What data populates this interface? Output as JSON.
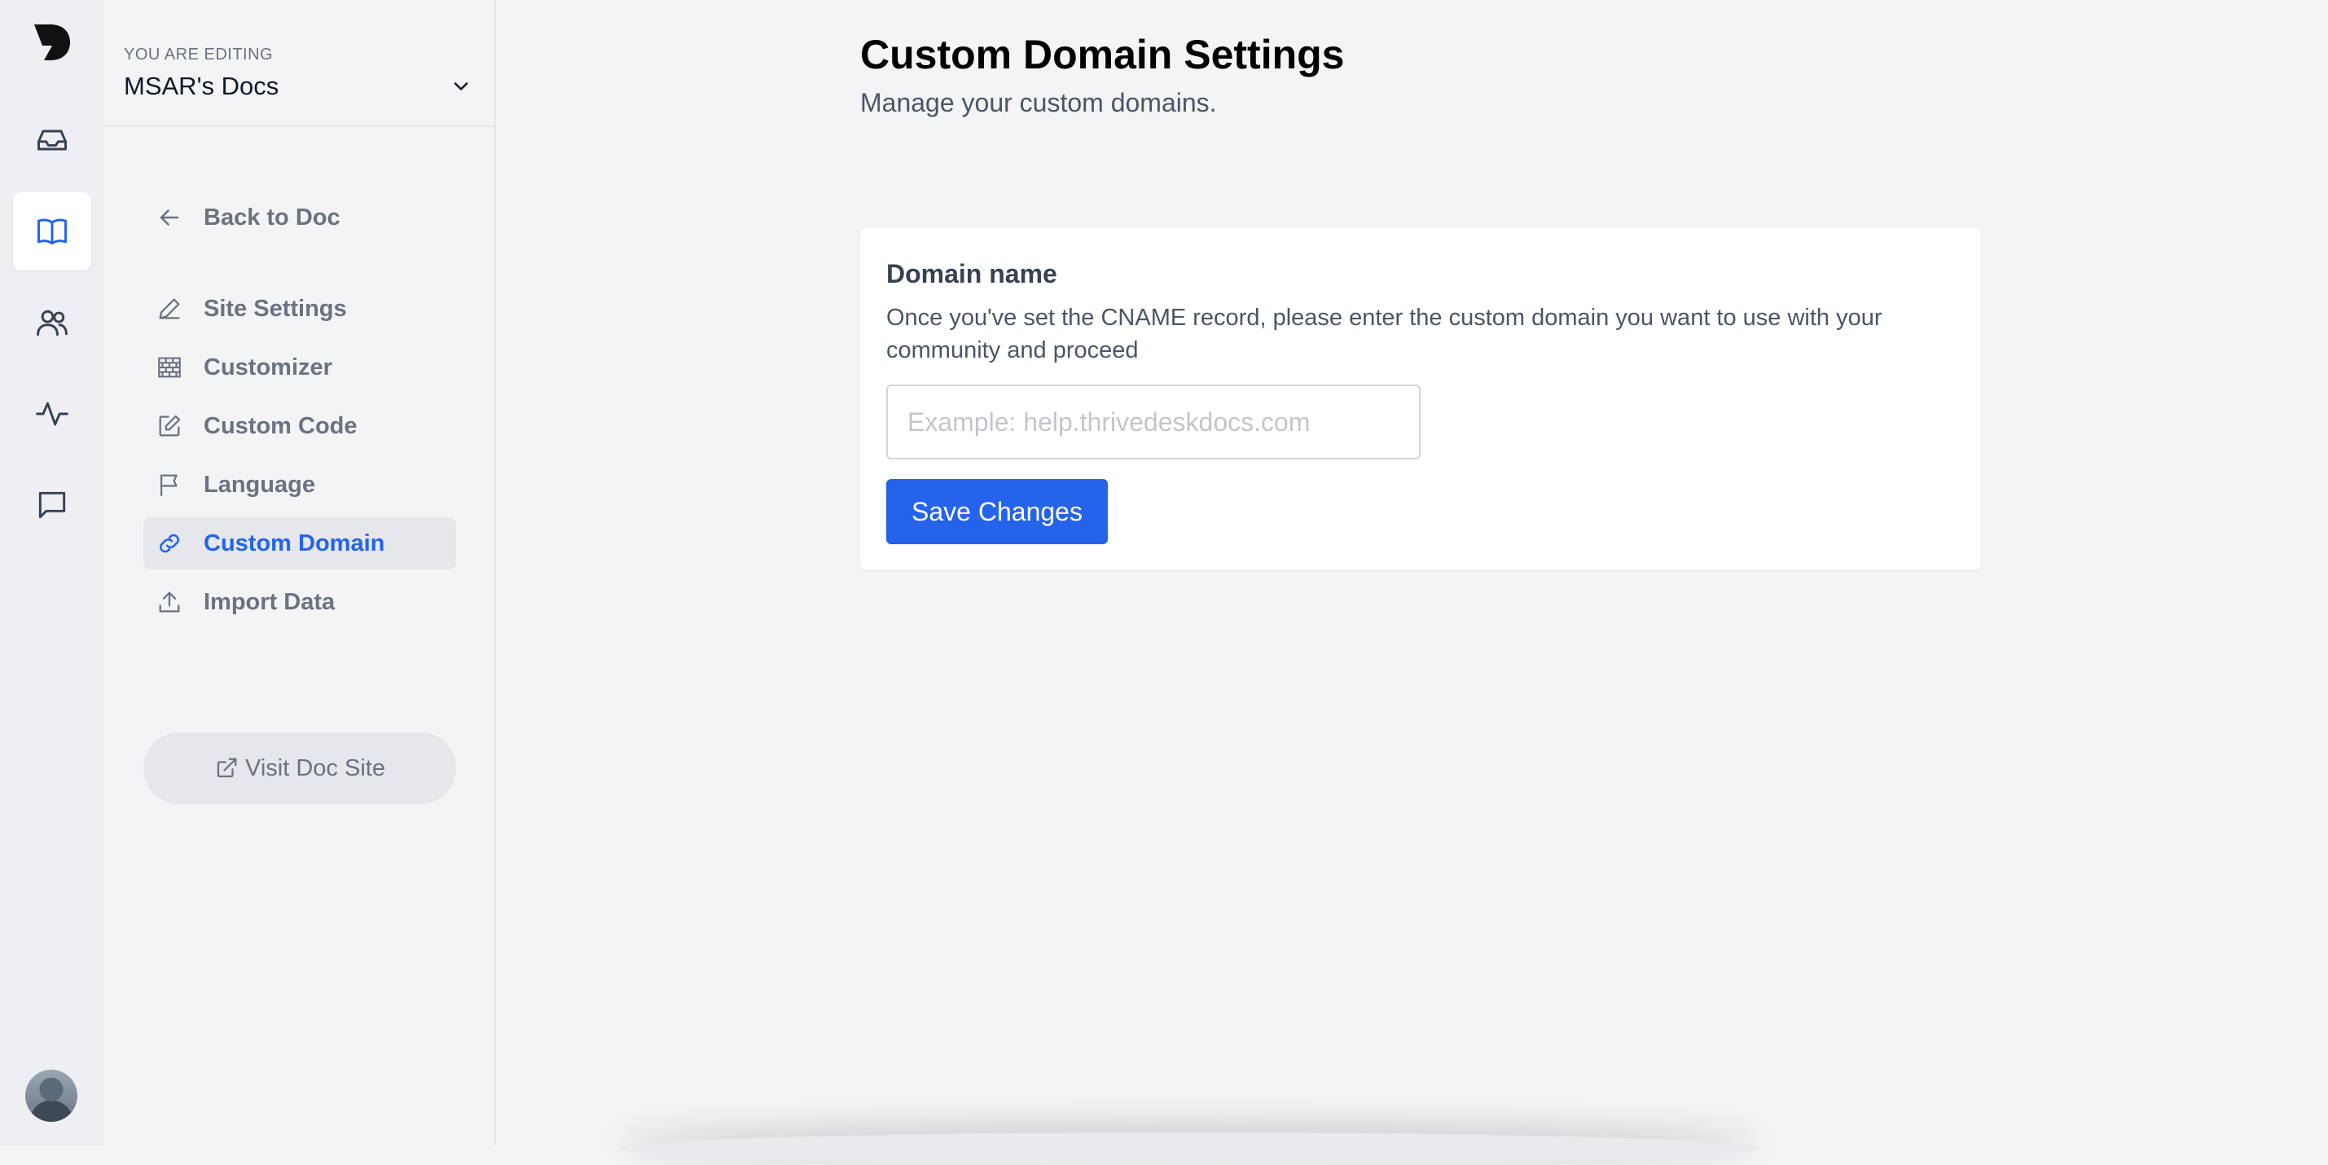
{
  "rail": {
    "logo_icon": "doc-d-logo",
    "items": [
      {
        "icon": "inbox-icon"
      },
      {
        "icon": "book-open-icon",
        "active": true
      },
      {
        "icon": "users-icon"
      },
      {
        "icon": "activity-icon"
      },
      {
        "icon": "chat-icon"
      }
    ],
    "avatar_icon": "user-avatar"
  },
  "sidebar": {
    "editing_label": "YOU ARE EDITING",
    "editing_name": "MSAR's Docs",
    "back_label": "Back to Doc",
    "items": [
      {
        "label": "Site Settings",
        "icon": "pencil-icon"
      },
      {
        "label": "Customizer",
        "icon": "brick-wall-icon"
      },
      {
        "label": "Custom Code",
        "icon": "edit-square-icon"
      },
      {
        "label": "Language",
        "icon": "flag-icon"
      },
      {
        "label": "Custom Domain",
        "icon": "link-icon",
        "active": true
      },
      {
        "label": "Import Data",
        "icon": "upload-icon"
      }
    ],
    "visit_label": "Visit Doc Site"
  },
  "main": {
    "title": "Custom Domain Settings",
    "subtitle": "Manage your custom domains.",
    "card": {
      "title": "Domain name",
      "description": "Once you've set the CNAME record, please enter the custom domain you want to use with your community and proceed",
      "input_placeholder": "Example: help.thrivedeskdocs.com",
      "input_value": "",
      "save_label": "Save Changes"
    }
  },
  "colors": {
    "accent": "#2563eb",
    "muted_text": "#6b7280",
    "background": "#f3f4f6"
  }
}
